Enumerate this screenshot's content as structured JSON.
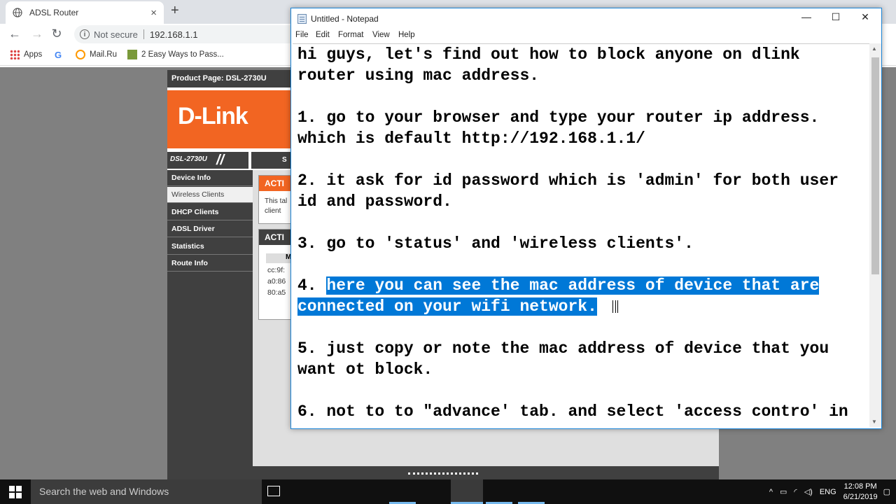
{
  "browser": {
    "tab_title": "ADSL Router",
    "tab_close": "×",
    "new_tab": "+",
    "back": "←",
    "forward": "→",
    "reload": "↻",
    "security_label": "Not secure",
    "url": "192.168.1.1",
    "bookmarks": [
      {
        "label": "Apps"
      },
      {
        "label": ""
      },
      {
        "label": "Mail.Ru"
      },
      {
        "label": "2 Easy Ways to Pass..."
      }
    ]
  },
  "router": {
    "product_page": "Product Page: DSL-2730U",
    "logo": "D-Link",
    "model": "DSL-2730U",
    "top_tab": "S",
    "menu": [
      {
        "label": "Device Info",
        "active": false
      },
      {
        "label": "Wireless Clients",
        "active": true
      },
      {
        "label": "DHCP Clients",
        "active": false
      },
      {
        "label": "ADSL Driver",
        "active": false
      },
      {
        "label": "Statistics",
        "active": false
      },
      {
        "label": "Route Info",
        "active": false
      }
    ],
    "box1_header": "ACTI",
    "box1_text_1": "This tal",
    "box1_text_2": "client",
    "box2_header": "ACTI",
    "box2_col": "M",
    "macs": [
      "cc:9f:",
      "a0:86",
      "80:a5"
    ]
  },
  "notepad": {
    "title": "Untitled - Notepad",
    "minimize": "—",
    "maximize": "☐",
    "close": "✕",
    "menu": [
      "File",
      "Edit",
      "Format",
      "View",
      "Help"
    ],
    "lines": [
      "hi guys, let's find out how to block anyone on dlink",
      "router using mac address.",
      "",
      "1. go to your browser and type your router ip address.",
      "which is default http://192.168.1.1/",
      "",
      "2. it ask for id password which is 'admin' for both user",
      "id and password.",
      "",
      "3. go to 'status' and 'wireless clients'.",
      "",
      "4. ",
      "here you can see the mac address of device that are",
      "connected on your wifi network.",
      "",
      "5. just copy or note the mac address of device that you",
      "want ot block.",
      "",
      "6. not to to \"advance' tab. and select 'access contro' in"
    ]
  },
  "taskbar": {
    "search_placeholder": "Search the web and Windows",
    "lang": "ENG",
    "time": "12:08 PM",
    "date": "6/21/2019",
    "tray_up": "^"
  },
  "colors": {
    "dlink_orange": "#f26522",
    "router_dark": "#404040",
    "selection": "#0078d7"
  }
}
